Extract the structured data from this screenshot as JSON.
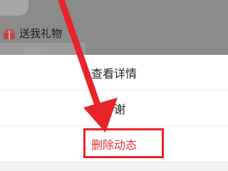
{
  "background": {
    "gift_label": "送我礼物",
    "gift_icon": "gift-icon"
  },
  "action_sheet": {
    "items": [
      {
        "label": "查看详情"
      },
      {
        "label": "答谢"
      },
      {
        "label": "删除动态"
      }
    ]
  },
  "colors": {
    "overlay": "#8f8f8f",
    "sheet_bg": "#ffffff",
    "delete_text": "#e2333f",
    "annotation_red": "#e8232a"
  },
  "annotation": {
    "arrow_icon": "red-arrow-icon"
  }
}
